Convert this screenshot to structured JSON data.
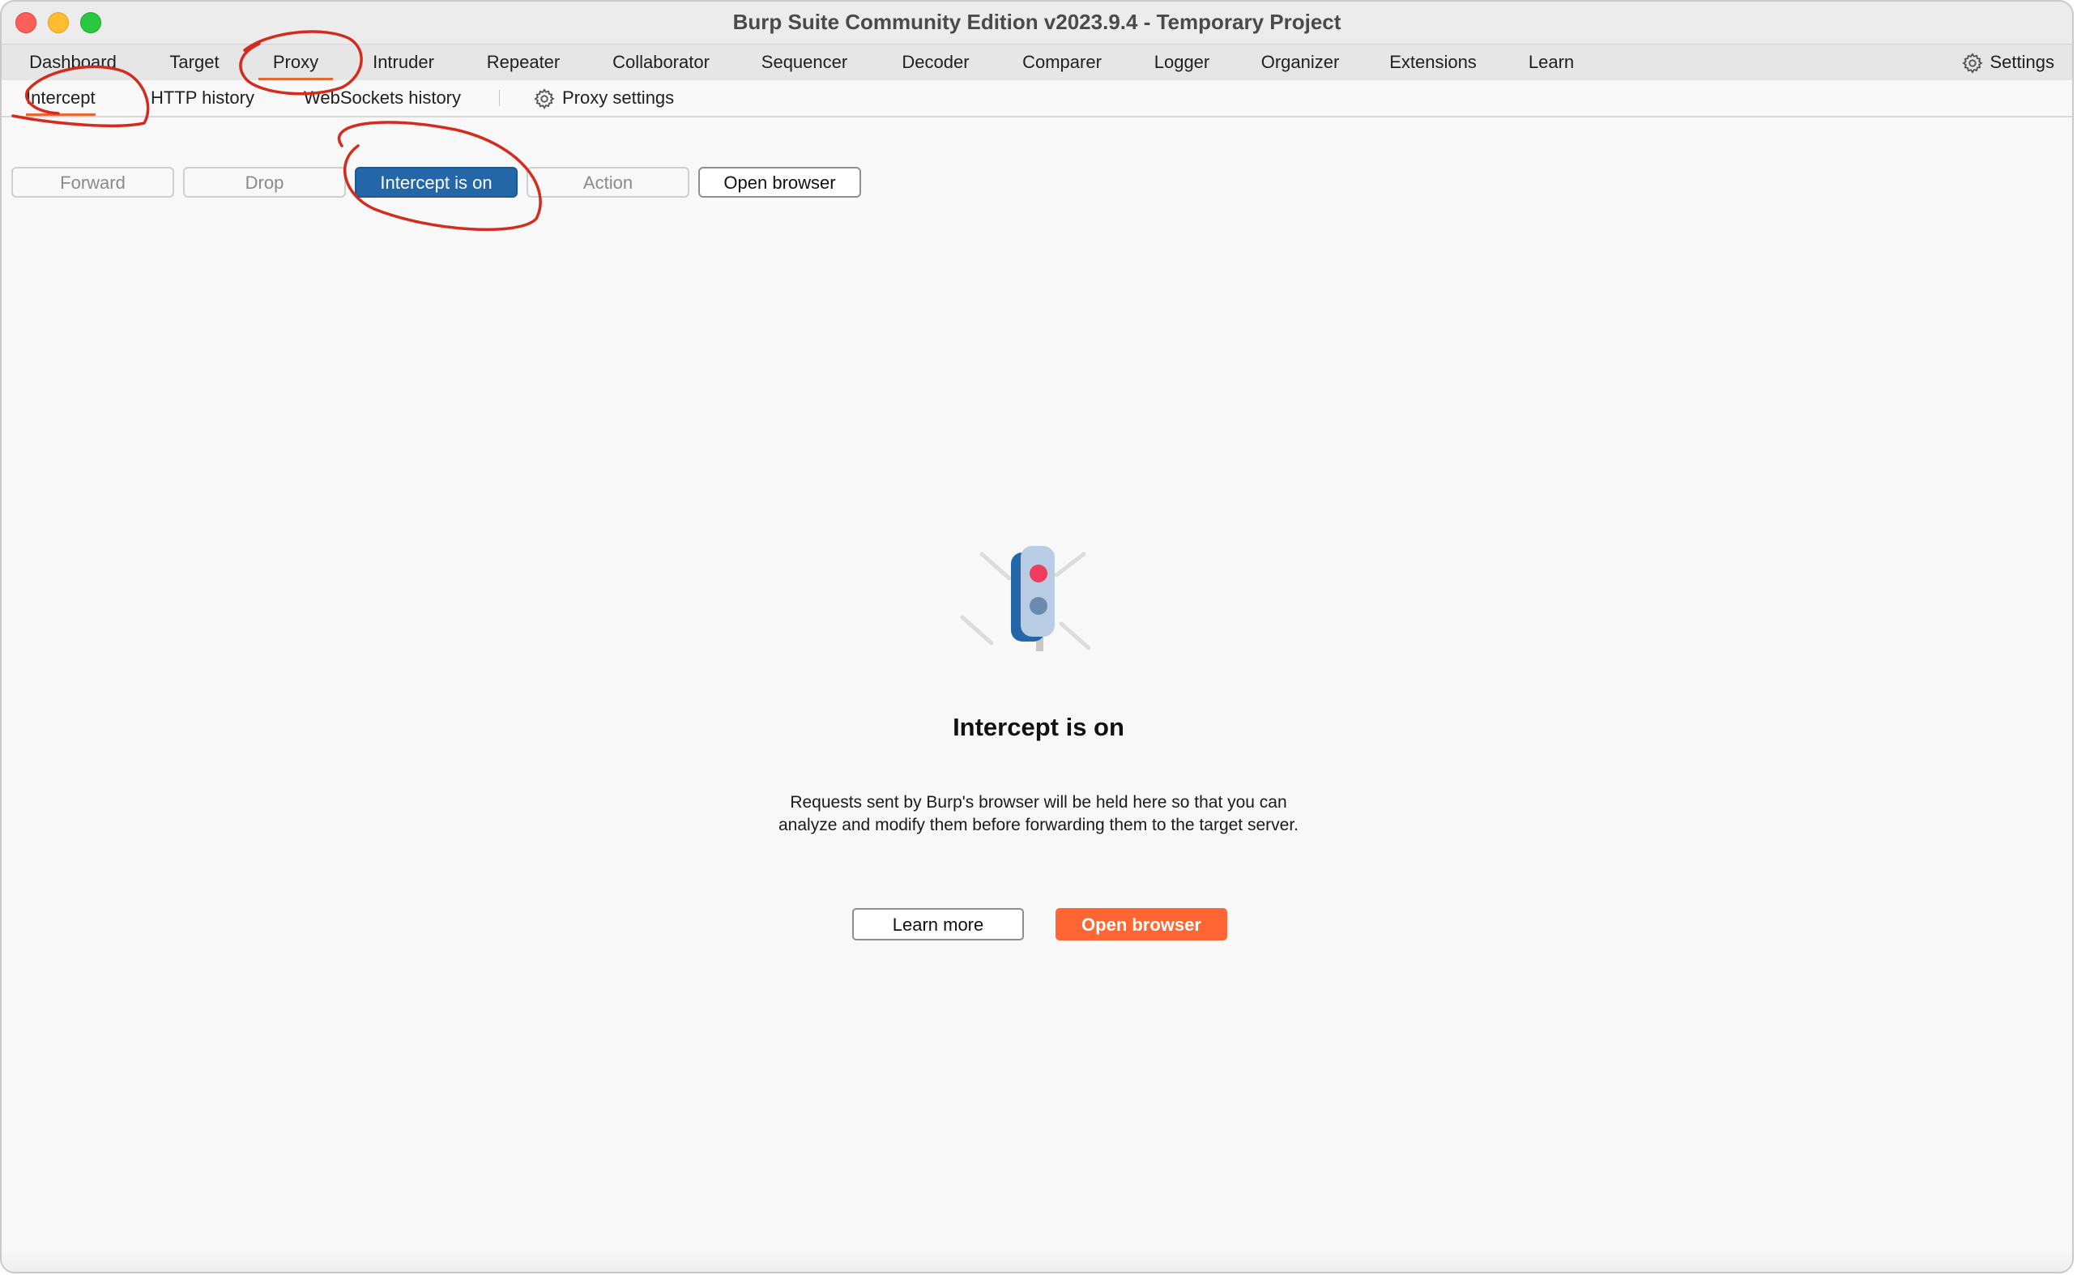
{
  "window": {
    "title": "Burp Suite Community Edition v2023.9.4 - Temporary Project"
  },
  "main_tabs": [
    "Dashboard",
    "Target",
    "Proxy",
    "Intruder",
    "Repeater",
    "Collaborator",
    "Sequencer",
    "Decoder",
    "Comparer",
    "Logger",
    "Organizer",
    "Extensions",
    "Learn"
  ],
  "active_main_tab": "Proxy",
  "settings_label": "Settings",
  "sub_tabs": [
    "Intercept",
    "HTTP history",
    "WebSockets history"
  ],
  "active_sub_tab": "Intercept",
  "proxy_settings_label": "Proxy settings",
  "toolbar": {
    "forward": "Forward",
    "drop": "Drop",
    "intercept_toggle": "Intercept is on",
    "action": "Action",
    "open_browser": "Open browser"
  },
  "empty_state": {
    "heading": "Intercept is on",
    "description": "Requests sent by Burp's browser will be held here so that you can analyze and modify them before forwarding them to the target server.",
    "learn_more": "Learn more",
    "open_browser": "Open browser"
  },
  "colors": {
    "accent_orange": "#ff6633",
    "intercept_blue": "#2467a8",
    "annotation_red": "#d42b1f"
  },
  "icons": [
    "gear-icon",
    "traffic-light-icon"
  ]
}
